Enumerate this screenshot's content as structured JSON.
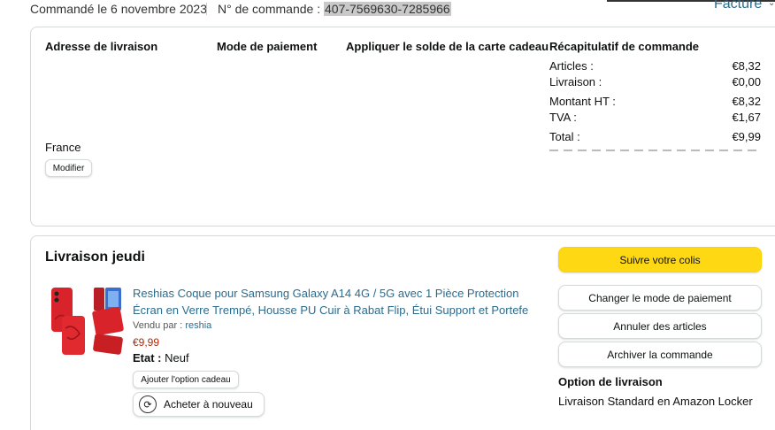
{
  "header": {
    "order_date": "Commandé le 6 novembre 2023",
    "order_number_label": "N° de commande :",
    "order_number": "407-7569630-7285966",
    "invoice_link": "Facture"
  },
  "details": {
    "shipping_address_title": "Adresse de livraison",
    "shipping_country": "France",
    "modify_button": "Modifier",
    "payment_title": "Mode de paiement",
    "gift_card_title": "Appliquer le solde de la carte cadeau",
    "summary_title": "Récapitulatif de commande",
    "summary": [
      {
        "label": "Articles :",
        "value": "€8,32"
      },
      {
        "label": "Livraison :",
        "value": "€0,00"
      },
      {
        "label": "Montant HT :",
        "value": "€8,32"
      },
      {
        "label": "TVA :",
        "value": "€1,67"
      },
      {
        "label": "Total :",
        "value": "€9,99"
      }
    ]
  },
  "shipment": {
    "title": "Livraison jeudi",
    "track_button": "Suivre votre colis",
    "change_payment_button": "Changer le mode de paiement",
    "cancel_items_button": "Annuler des articles",
    "archive_button": "Archiver la commande",
    "delivery_option_title": "Option de livraison",
    "delivery_option_value": "Livraison Standard en Amazon Locker",
    "product": {
      "title": "Reshias Coque pour Samsung Galaxy A14 4G / 5G avec 1 Pièce Protection Écran en Verre Trempé, Housse PU Cuir à Rabat Flip, Étui Support et Portefe",
      "sold_by_label": "Vendu par :",
      "seller": "reshia",
      "price": "€9,99",
      "condition_label": "Etat :",
      "condition_value": "Neuf",
      "gift_option_button": "Ajouter l'option cadeau",
      "buy_again_button": "Acheter à nouveau",
      "buy_again_icon": "refresh-cart-icon"
    }
  },
  "colors": {
    "link": "#2a6c8f",
    "price": "#b12704",
    "primary_button": "#ffd814",
    "border": "#d5d9d9"
  }
}
